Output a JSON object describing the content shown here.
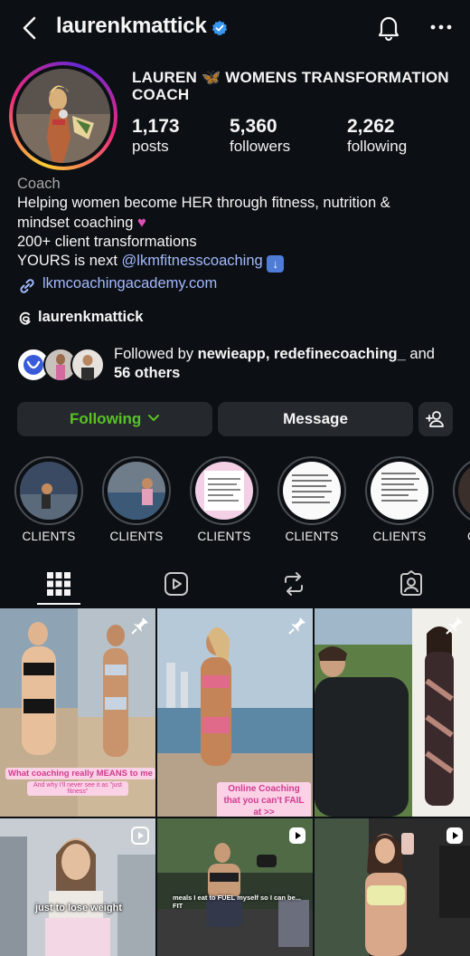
{
  "header": {
    "username": "laurenkmattick",
    "icons": [
      "back-chevron-icon",
      "verified-badge-icon",
      "bell-icon",
      "more-icon"
    ]
  },
  "profile": {
    "full_name": "LAUREN 🦋 WOMENS TRANSFORMATION COACH",
    "stats": [
      {
        "value": "1,173",
        "label": "posts"
      },
      {
        "value": "5,360",
        "label": "followers"
      },
      {
        "value": "2,262",
        "label": "following"
      }
    ],
    "category": "Coach",
    "bio_line1": "Helping women become HER through fitness, nutrition &",
    "bio_line2": "mindset coaching",
    "bio_line3": "200+ client transformations",
    "bio_line4_prefix": "YOURS is next",
    "bio_mention": "@lkmfitnesscoaching",
    "link": "lkmcoachingacademy.com",
    "threads_handle": "laurenkmattick"
  },
  "followed_by": {
    "prefix": "Followed by",
    "names": "newieapp, redefinecoaching_",
    "and": "and",
    "others": "56 others"
  },
  "actions": {
    "following_label": "Following",
    "message_label": "Message"
  },
  "highlights": [
    {
      "label": "CLIENTS"
    },
    {
      "label": "CLIENTS"
    },
    {
      "label": "CLIENTS"
    },
    {
      "label": "CLIENTS"
    },
    {
      "label": "CLIENTS"
    },
    {
      "label": "C"
    }
  ],
  "tabs": [
    "grid-icon",
    "reels-icon",
    "reposts-icon",
    "tagged-icon"
  ],
  "posts": [
    {
      "caption": "What coaching really MEANS to me",
      "subcaption": "And why I'll never see it as \"just fitness\"",
      "pinned": true
    },
    {
      "caption": "Online Coaching that you can't FAIL at >>",
      "pinned": true
    },
    {
      "caption": "",
      "pinned": true
    },
    {
      "caption": "just to lose weight",
      "reel": true
    },
    {
      "caption": "meals I eat to FUEL myself so I can be... FIT",
      "reel": true
    },
    {
      "caption": "",
      "reel": true
    }
  ],
  "colors": {
    "background": "#0c1014",
    "button": "#25292e",
    "following_green": "#58c322",
    "link_blue": "#a3b8ff",
    "verified_blue": "#3897f0"
  }
}
